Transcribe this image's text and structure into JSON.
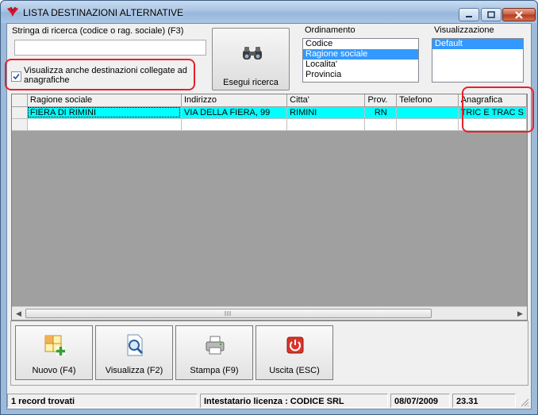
{
  "window": {
    "title": "LISTA DESTINAZIONI ALTERNATIVE"
  },
  "search": {
    "label": "Stringa di ricerca (codice o rag. sociale) (F3)",
    "value": ""
  },
  "checkbox": {
    "label": "Visualizza anche destinazioni collegate ad anagrafiche",
    "checked": true
  },
  "search_button": {
    "label": "Esegui ricerca",
    "icon": "binoculars-icon"
  },
  "ordinamento": {
    "label": "Ordinamento",
    "items": [
      "Codice",
      "Ragione sociale",
      "Localita'",
      "Provincia"
    ],
    "selected": "Ragione sociale"
  },
  "visualizzazione": {
    "label": "Visualizzazione",
    "items": [
      "Default"
    ],
    "selected": "Default"
  },
  "grid": {
    "columns": [
      "Ragione sociale",
      "Indirizzo",
      "Citta'",
      "Prov.",
      "Telefono",
      "Anagrafica"
    ],
    "rows": [
      [
        "FIERA DI RIMINI",
        "VIA DELLA FIERA, 99",
        "RIMINI",
        "RN",
        "",
        "TRIC E TRAC S"
      ]
    ]
  },
  "toolbar": {
    "new_label": "Nuovo (F4)",
    "view_label": "Visualizza (F2)",
    "print_label": "Stampa (F9)",
    "exit_label": "Uscita (ESC)"
  },
  "status": {
    "records": "1 record trovati",
    "license": "Intestatario licenza : CODICE SRL",
    "date": "08/07/2009",
    "time": "23.31"
  },
  "colors": {
    "selected_row": "#00ffff",
    "highlight": "#e8202a",
    "list_selection": "#3399ff"
  }
}
